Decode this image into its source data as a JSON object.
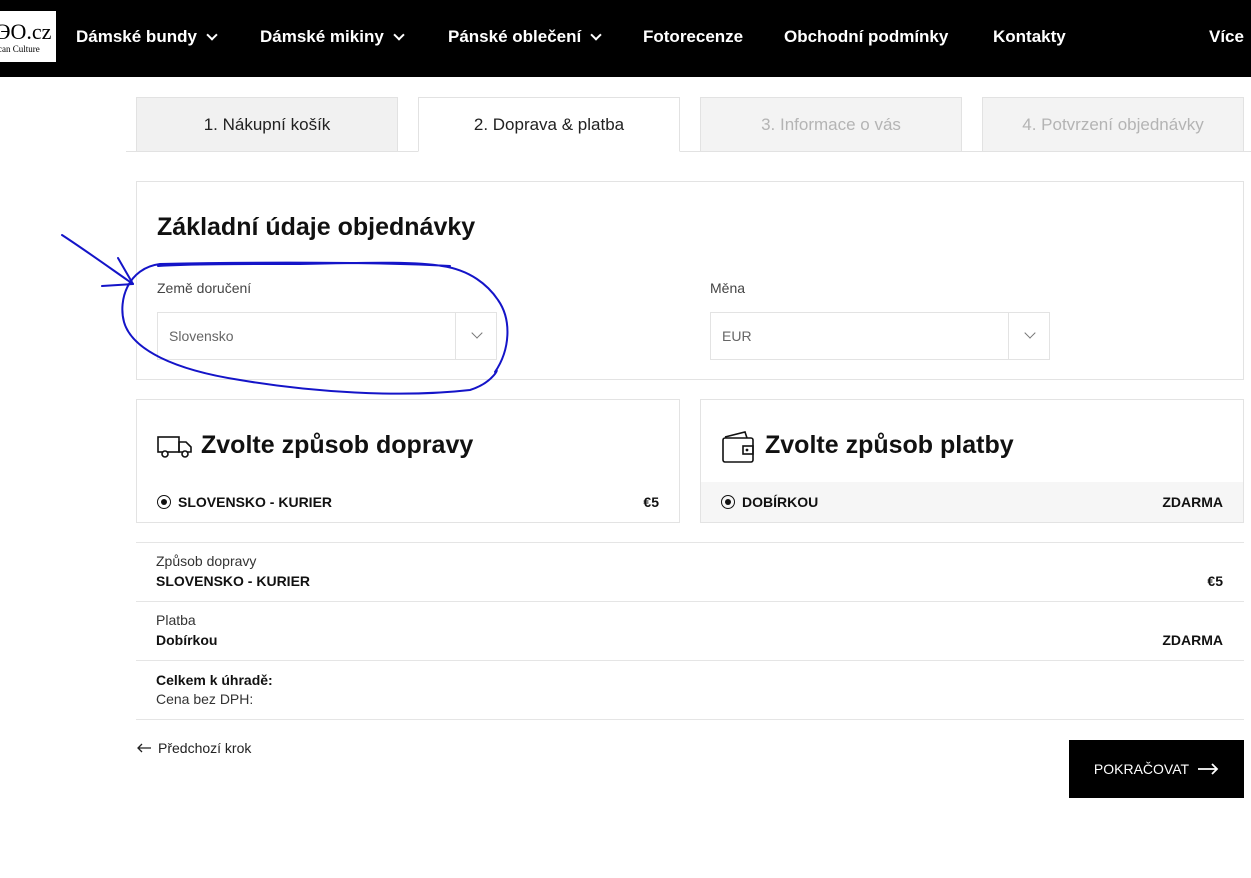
{
  "logo": {
    "main": "ЭO.cz",
    "sub": "can Culture"
  },
  "nav": {
    "items": [
      {
        "label": "Dámské bundy",
        "has_dropdown": true
      },
      {
        "label": "Dámské mikiny",
        "has_dropdown": true
      },
      {
        "label": "Pánské oblečení",
        "has_dropdown": true
      },
      {
        "label": "Fotorecenze",
        "has_dropdown": false
      },
      {
        "label": "Obchodní podmínky",
        "has_dropdown": false
      },
      {
        "label": "Kontakty",
        "has_dropdown": false
      },
      {
        "label": "Více",
        "has_dropdown": false
      }
    ]
  },
  "steps": [
    {
      "label": "1. Nákupní košík",
      "state": "done"
    },
    {
      "label": "2. Doprava & platba",
      "state": "active"
    },
    {
      "label": "3. Informace o vás",
      "state": "pending"
    },
    {
      "label": "4. Potvrzení objednávky",
      "state": "pending"
    }
  ],
  "basics": {
    "title": "Základní údaje objednávky",
    "country_label": "Země doručení",
    "country_value": "Slovensko",
    "currency_label": "Měna",
    "currency_value": "EUR"
  },
  "shipping": {
    "title": "Zvolte způsob dopravy",
    "icon": "truck-icon",
    "option_name": "SLOVENSKO - KURIER",
    "option_price": "€5"
  },
  "payment": {
    "title": "Zvolte způsob platby",
    "icon": "wallet-icon",
    "option_name": "DOBÍRKOU",
    "option_price": "ZDARMA"
  },
  "summary": {
    "shipping_label": "Způsob dopravy",
    "shipping_value": "SLOVENSKO - KURIER",
    "shipping_price": "€5",
    "payment_label": "Platba",
    "payment_value": "Dobírkou",
    "payment_price": "ZDARMA",
    "total_label": "Celkem k úhradě:",
    "net_label": "Cena bez DPH:"
  },
  "actions": {
    "back_label": "Předchozí krok",
    "continue_label": "POKRAČOVAT"
  },
  "colors": {
    "topbar": "#000000",
    "annotation": "#1414c8",
    "pending_text": "#b4b4b4"
  }
}
